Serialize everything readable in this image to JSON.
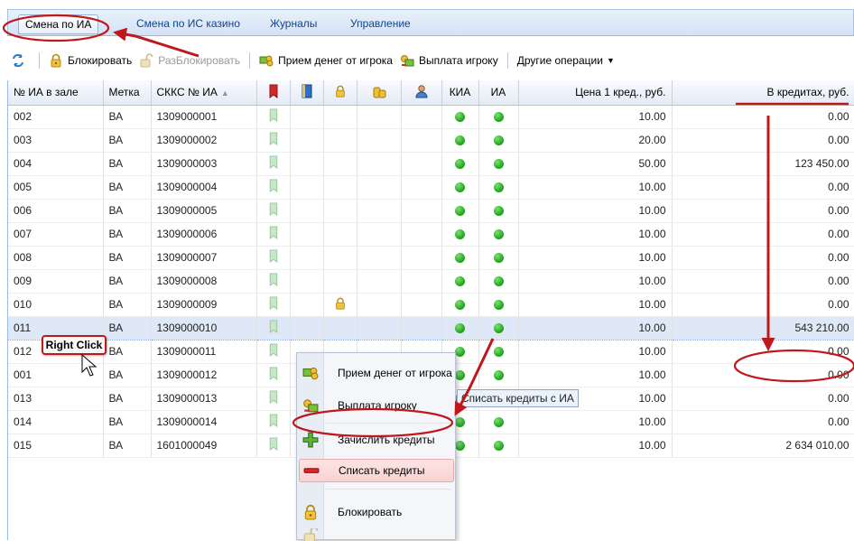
{
  "tabs": [
    {
      "label": "Смена по ИА",
      "active": true
    },
    {
      "label": "Смена по ИС казино"
    },
    {
      "label": "Журналы"
    },
    {
      "label": "Управление"
    }
  ],
  "toolbar": {
    "block": "Блокировать",
    "unblock": "РазБлокировать",
    "accept_money": "Прием денег от игрока",
    "payout": "Выплата игроку",
    "other_ops": "Другие операции"
  },
  "columns": {
    "num": "№ ИА в зале",
    "mark": "Метка",
    "skks": "СККС № ИА",
    "kia": "КИА",
    "ia": "ИА",
    "price": "Цена 1 кред., руб.",
    "credits": "В кредитах, руб."
  },
  "rows": [
    {
      "num": "002",
      "mark": "ВА",
      "skks": "1309000001",
      "price": "10.00",
      "credits": "0.00"
    },
    {
      "num": "003",
      "mark": "ВА",
      "skks": "1309000002",
      "price": "20.00",
      "credits": "0.00"
    },
    {
      "num": "004",
      "mark": "ВА",
      "skks": "1309000003",
      "price": "50.00",
      "credits": "123 450.00"
    },
    {
      "num": "005",
      "mark": "ВА",
      "skks": "1309000004",
      "price": "10.00",
      "credits": "0.00"
    },
    {
      "num": "006",
      "mark": "ВА",
      "skks": "1309000005",
      "price": "10.00",
      "credits": "0.00"
    },
    {
      "num": "007",
      "mark": "ВА",
      "skks": "1309000006",
      "price": "10.00",
      "credits": "0.00"
    },
    {
      "num": "008",
      "mark": "ВА",
      "skks": "1309000007",
      "price": "10.00",
      "credits": "0.00"
    },
    {
      "num": "009",
      "mark": "ВА",
      "skks": "1309000008",
      "price": "10.00",
      "credits": "0.00"
    },
    {
      "num": "010",
      "mark": "ВА",
      "skks": "1309000009",
      "price": "10.00",
      "credits": "0.00",
      "locked": true
    },
    {
      "num": "011",
      "mark": "ВА",
      "skks": "1309000010",
      "price": "10.00",
      "credits": "543 210.00",
      "selected": true
    },
    {
      "num": "012",
      "mark": "ВА",
      "skks": "1309000011",
      "price": "10.00",
      "credits": "0.00"
    },
    {
      "num": "001",
      "mark": "ВА",
      "skks": "1309000012",
      "price": "10.00",
      "credits": "0.00"
    },
    {
      "num": "013",
      "mark": "ВА",
      "skks": "1309000013",
      "price": "10.00",
      "credits": "0.00"
    },
    {
      "num": "014",
      "mark": "ВА",
      "skks": "1309000014",
      "price": "10.00",
      "credits": "0.00"
    },
    {
      "num": "015",
      "mark": "ВА",
      "skks": "1601000049",
      "price": "10.00",
      "credits": "2 634 010.00"
    }
  ],
  "context_menu": [
    {
      "label": "Прием денег от игрока",
      "icon": "money-in-icon"
    },
    {
      "label": "Выплата игроку",
      "icon": "payout-icon"
    },
    {
      "label": "Зачислить кредиты",
      "icon": "plus-icon"
    },
    {
      "label": "Списать кредиты",
      "icon": "minus-icon",
      "hover": true
    },
    {
      "label": "Блокировать",
      "icon": "lock-icon"
    }
  ],
  "tooltip": "Списать кредиты с ИА",
  "callout": "Right Click",
  "colors": {
    "status_dot": "#1ea01a",
    "annotation_red": "#c0171b",
    "selected_row": "#dfe8f6"
  }
}
